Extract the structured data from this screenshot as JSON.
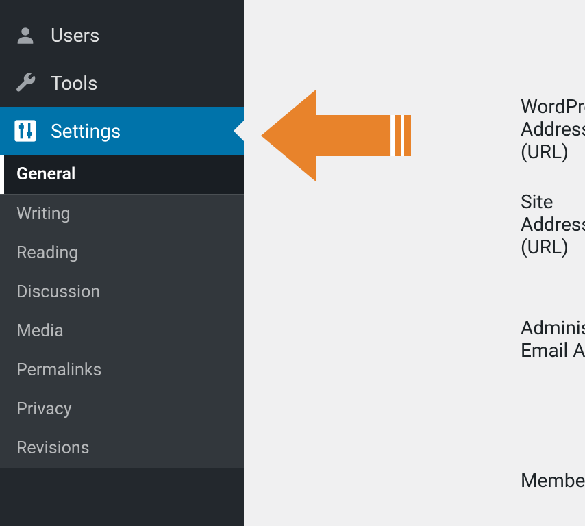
{
  "sidebar": {
    "items": [
      {
        "label": "Users"
      },
      {
        "label": "Tools"
      },
      {
        "label": "Settings"
      }
    ],
    "submenu": [
      {
        "label": "General",
        "active": true
      },
      {
        "label": "Writing"
      },
      {
        "label": "Reading"
      },
      {
        "label": "Discussion"
      },
      {
        "label": "Media"
      },
      {
        "label": "Permalinks"
      },
      {
        "label": "Privacy"
      },
      {
        "label": "Revisions"
      }
    ]
  },
  "content": {
    "fields": [
      {
        "label": "WordPress Address (URL)"
      },
      {
        "label": "Site Address (URL)"
      },
      {
        "label": "Administration Email Address"
      },
      {
        "label": "Membership"
      }
    ]
  },
  "annotation": {
    "arrow_color": "#e8832b"
  }
}
